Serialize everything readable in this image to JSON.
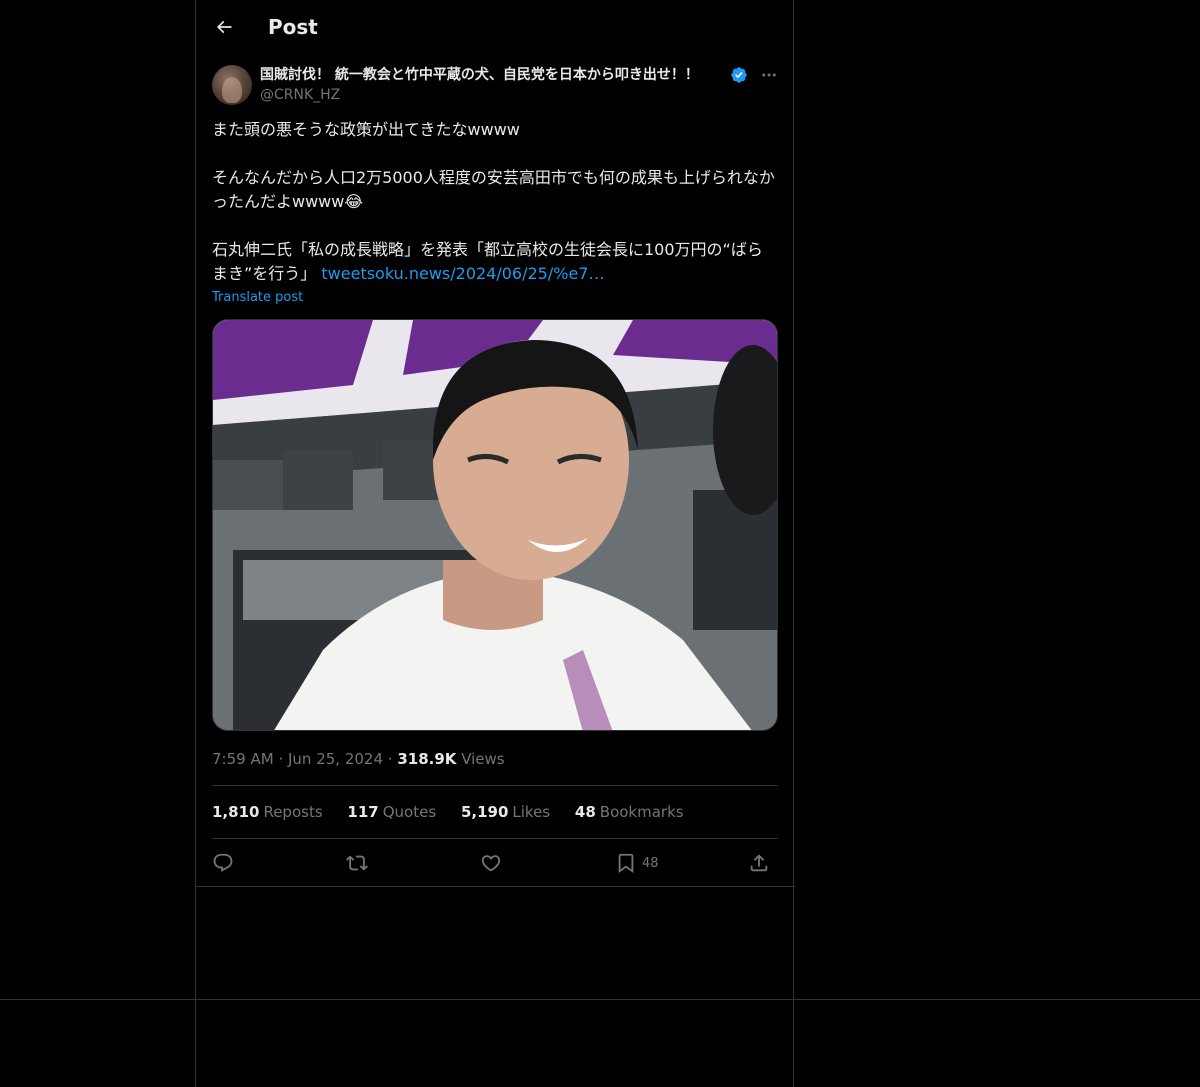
{
  "header": {
    "title": "Post",
    "back_icon": "arrow-left-icon"
  },
  "author": {
    "display_name": "国賊討伐！ 統一教会と竹中平蔵の犬、自民党を日本から叩き出せ！！",
    "handle": "@CRNK_HZ",
    "verified": true,
    "verified_color": "#1d9bf0"
  },
  "tweet": {
    "text_before_link": "また頭の悪そうな政策が出てきたなwwww\n\nそんなんだから人口2万5000人程度の安芸高田市でも何の成果も上げられなかったんだよwwww😂\n\n石丸伸二氏「私の成長戦略」を発表「都立高校の生徒会長に100万円の“ばらまき”を行う」 ",
    "link_text": "tweetsoku.news/2024/06/25/%e7…",
    "translate_label": "Translate post"
  },
  "meta": {
    "time": "7:59 AM",
    "date": "Jun 25, 2024",
    "views_count": "318.9K",
    "views_label": "Views"
  },
  "stats": {
    "reposts_count": "1,810",
    "reposts_label": "Reposts",
    "quotes_count": "117",
    "quotes_label": "Quotes",
    "likes_count": "5,190",
    "likes_label": "Likes",
    "bookmarks_count": "48",
    "bookmarks_label": "Bookmarks"
  },
  "actions": {
    "reply_icon": "reply-icon",
    "repost_icon": "repost-icon",
    "like_icon": "heart-icon",
    "bookmark_icon": "bookmark-icon",
    "bookmark_count": "48",
    "share_icon": "share-icon"
  },
  "colors": {
    "background": "#000000",
    "border": "#2f3336",
    "text_primary": "#e7e9ea",
    "text_secondary": "#71767b",
    "accent": "#1d9bf0"
  }
}
